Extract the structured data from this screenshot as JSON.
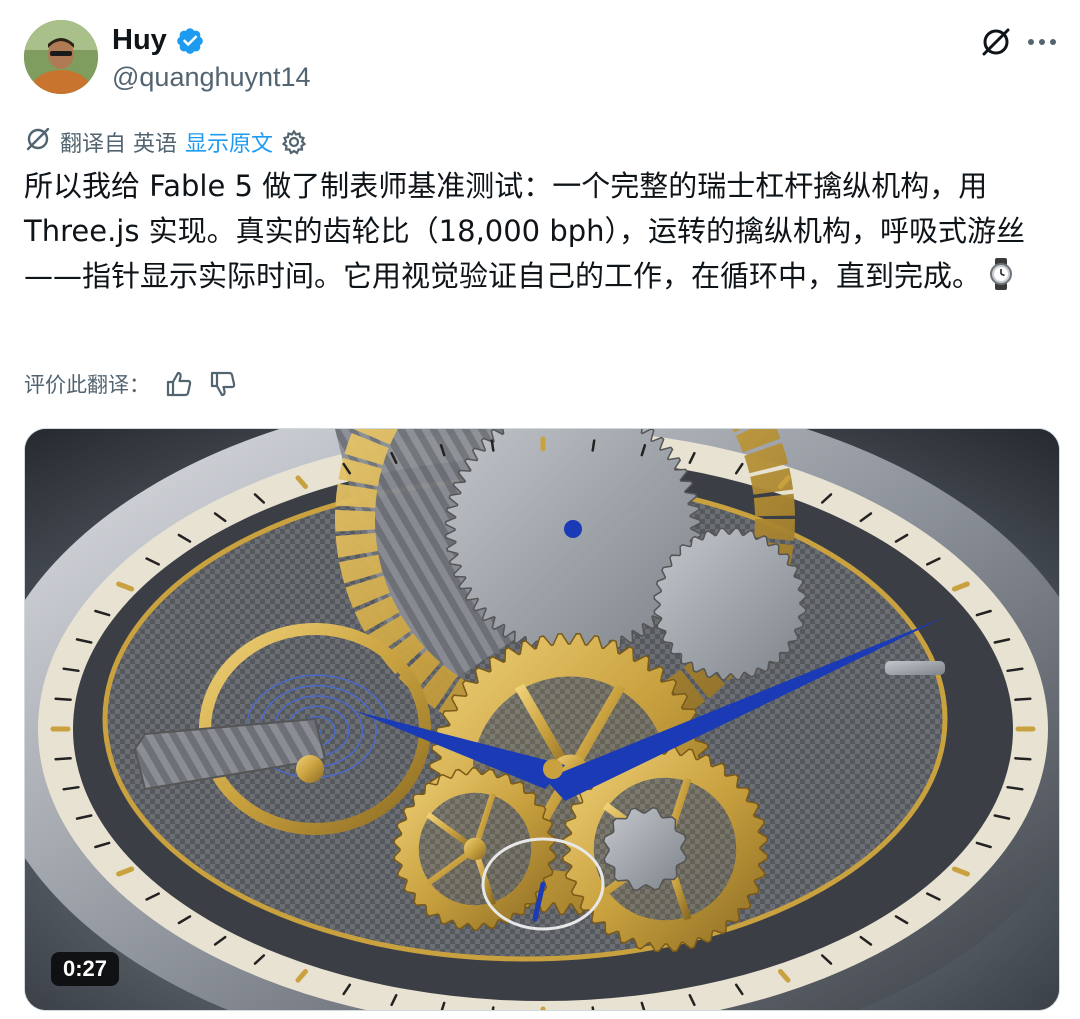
{
  "author": {
    "name": "Huy",
    "handle": "@quanghuynt14",
    "verified": true
  },
  "translation": {
    "label": "翻译自 英语",
    "show_original": "显示原文"
  },
  "tweet": {
    "text": "所以我给 Fable 5 做了制表师基准测试：一个完整的瑞士杠杆擒纵机构，用 Three.js 实现。真实的齿轮比（18,000 bph），运转的擒纵机构，呼吸式游丝——指针显示实际时间。它用视觉验证自己的工作，在循环中，直到完成。"
  },
  "rating": {
    "label": "评价此翻译："
  },
  "media": {
    "type": "video",
    "duration": "0:27"
  },
  "colors": {
    "accent": "#1d9bf0",
    "text_secondary": "#536471",
    "hands": "#1a3bb5",
    "gold": "#c9a13f"
  },
  "icons": [
    "grok-icon",
    "more-icon",
    "translate-icon",
    "gear-icon",
    "watch-emoji-icon",
    "thumbs-up-icon",
    "thumbs-down-icon",
    "verified-badge-icon"
  ]
}
